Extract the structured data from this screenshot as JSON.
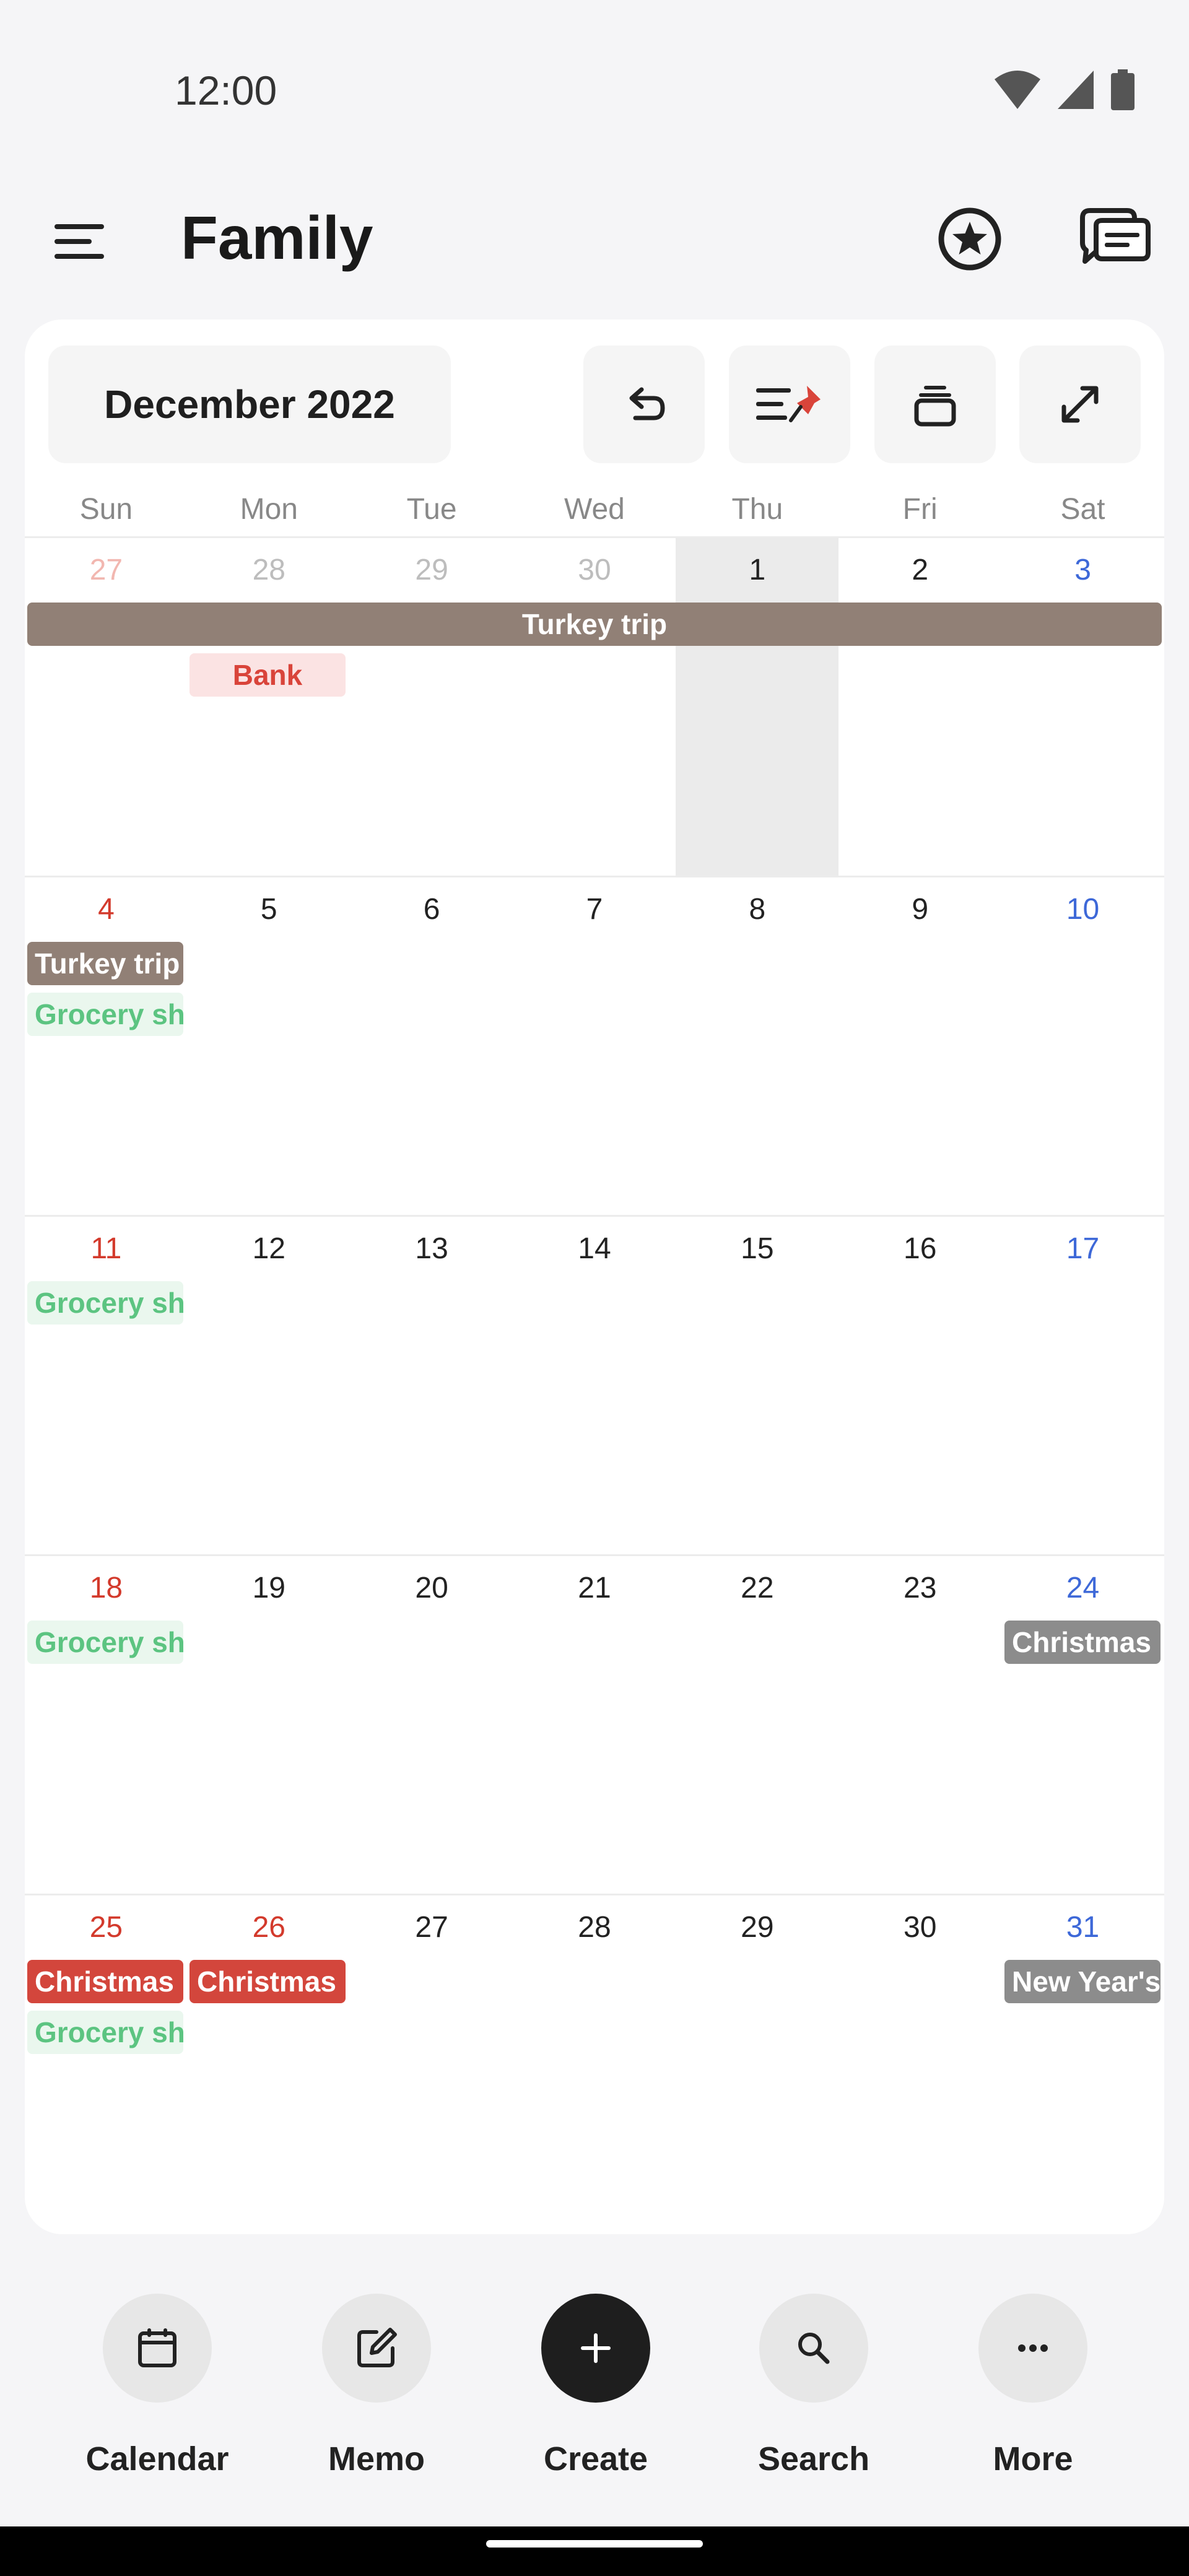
{
  "status_bar": {
    "time": "12:00"
  },
  "app_bar": {
    "title": "Family"
  },
  "calendar": {
    "month_label": "December 2022",
    "weekdays": [
      "Sun",
      "Mon",
      "Tue",
      "Wed",
      "Thu",
      "Fri",
      "Sat"
    ],
    "weeks": [
      {
        "days": [
          "27",
          "28",
          "29",
          "30",
          "1",
          "2",
          "3"
        ]
      },
      {
        "days": [
          "4",
          "5",
          "6",
          "7",
          "8",
          "9",
          "10"
        ]
      },
      {
        "days": [
          "11",
          "12",
          "13",
          "14",
          "15",
          "16",
          "17"
        ]
      },
      {
        "days": [
          "18",
          "19",
          "20",
          "21",
          "22",
          "23",
          "24"
        ]
      },
      {
        "days": [
          "25",
          "26",
          "27",
          "28",
          "29",
          "30",
          "31"
        ]
      }
    ],
    "today": "1",
    "events": {
      "turkey_trip": "Turkey trip",
      "bank": "Bank",
      "grocery": "Grocery shopping",
      "christmas": "Christmas",
      "new_years": "New Year's"
    }
  },
  "bottom_nav": {
    "items": [
      {
        "label": "Calendar",
        "icon": "calendar-icon"
      },
      {
        "label": "Memo",
        "icon": "edit-icon"
      },
      {
        "label": "Create",
        "icon": "plus-icon"
      },
      {
        "label": "Search",
        "icon": "search-icon"
      },
      {
        "label": "More",
        "icon": "more-icon"
      }
    ]
  },
  "colors": {
    "sunday": "#d33a2c",
    "saturday": "#3d68d8",
    "event_trip": "#918076",
    "event_grocery": "#5cc481",
    "event_bank": "#d9443a",
    "event_holiday": "#d3463c",
    "event_other_holiday": "#8c8c8c"
  }
}
